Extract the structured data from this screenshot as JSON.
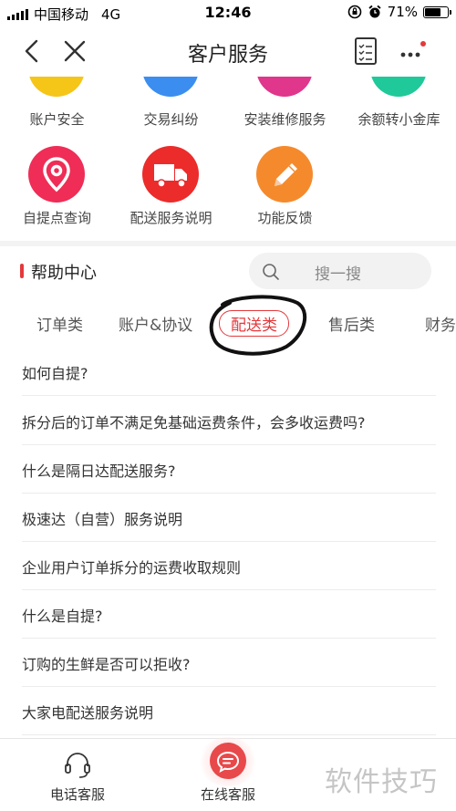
{
  "status_bar": {
    "carrier": "中国移动",
    "network": "4G",
    "time": "12:46",
    "battery_percent": "71%",
    "battery_level": 0.71
  },
  "nav": {
    "title": "客户服务"
  },
  "services": {
    "row1": [
      {
        "label": "账户安全",
        "color": "#f5c518"
      },
      {
        "label": "交易纠纷",
        "color": "#3b8ef0"
      },
      {
        "label": "安装维修服务",
        "color": "#e0368c"
      },
      {
        "label": "余额转小金库",
        "color": "#1fc99a"
      }
    ],
    "row2": [
      {
        "label": "自提点查询",
        "color": "#ef2d56",
        "icon": "location-pin-icon"
      },
      {
        "label": "配送服务说明",
        "color": "#ec2b2b",
        "icon": "truck-icon"
      },
      {
        "label": "功能反馈",
        "color": "#f58a2c",
        "icon": "pencil-icon"
      }
    ]
  },
  "help_center": {
    "title": "帮助中心",
    "search_placeholder": "搜一搜"
  },
  "tabs": [
    {
      "label": "订单类",
      "active": false
    },
    {
      "label": "账户&协议",
      "active": false
    },
    {
      "label": "配送类",
      "active": true
    },
    {
      "label": "售后类",
      "active": false
    },
    {
      "label": "财务",
      "active": false
    }
  ],
  "faq": [
    "如何自提?",
    "拆分后的订单不满足免基础运费条件，会多收运费吗?",
    "什么是隔日达配送服务?",
    "极速达（自营）服务说明",
    "企业用户订单拆分的运费收取规则",
    "什么是自提?",
    "订购的生鲜是否可以拒收?",
    "大家电配送服务说明"
  ],
  "bottom_bar": {
    "phone_label": "电话客服",
    "chat_label": "在线客服"
  },
  "watermark": "软件技巧",
  "accent_color": "#e4393c"
}
